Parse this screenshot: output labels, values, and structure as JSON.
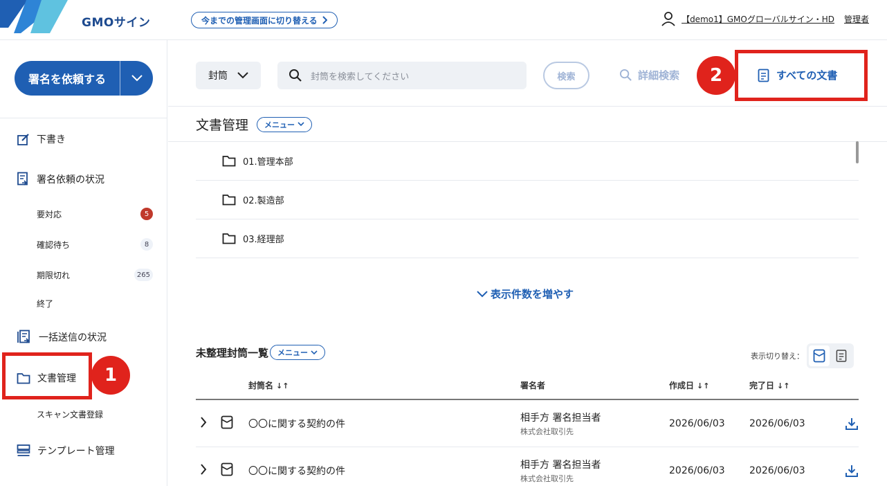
{
  "header": {
    "brand": "GMOサイン",
    "switch_label": "今までの管理画面に切り替える",
    "user_name": "【demo1】GMOグローバルサイン・HD",
    "user_role": "管理者"
  },
  "sidebar": {
    "request_button": "署名を依頼する",
    "items": {
      "draft": "下書き",
      "request_status": "署名依頼の状況",
      "action_required": "要対応",
      "action_required_count": "5",
      "awaiting": "確認待ち",
      "awaiting_count": "8",
      "expired": "期限切れ",
      "expired_count": "265",
      "completed": "終了",
      "bulk_status": "一括送信の状況",
      "doc_management": "文書管理",
      "scan_register": "スキャン文書登録",
      "template_management": "テンプレート管理"
    }
  },
  "toolbar": {
    "select_value": "封筒",
    "search_placeholder": "封筒を検索してください",
    "search_button": "検索",
    "advanced_search": "詳細検索",
    "all_documents": "すべての文書"
  },
  "document": {
    "title": "文書管理",
    "menu_label": "メニュー",
    "folders": [
      "01.管理本部",
      "02.製造部",
      "03.経理部"
    ],
    "show_more": "表示件数を増やす"
  },
  "unorganized": {
    "title": "未整理封筒一覧",
    "menu_label": "メニュー",
    "view_toggle_label": "表示切り替え：",
    "columns": {
      "name": "封筒名",
      "signer": "署名者",
      "created": "作成日",
      "completed": "完了日"
    },
    "rows": [
      {
        "name": "〇〇に関する契約の件",
        "signer": "相手方 署名担当者",
        "company": "株式会社取引先",
        "created": "2026/06/03",
        "completed": "2026/06/03"
      },
      {
        "name": "〇〇に関する契約の件",
        "signer": "相手方 署名担当者",
        "company": "株式会社取引先",
        "created": "2026/06/03",
        "completed": "2026/06/03"
      }
    ]
  },
  "annotations": {
    "step1": "1",
    "step2": "2"
  },
  "colors": {
    "primary": "#1f5fb3",
    "highlight": "#e0231c",
    "badge_red": "#c0392b"
  }
}
